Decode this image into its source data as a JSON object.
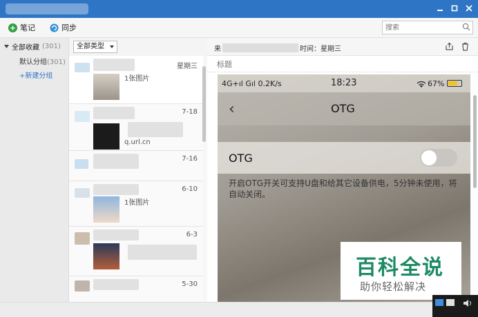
{
  "toolbar": {
    "note_label": "笔记",
    "sync_label": "同步",
    "search_placeholder": "搜索"
  },
  "sidebar": {
    "root_label": "全部收藏",
    "root_count": "(301)",
    "group_label": "默认分组",
    "group_count": "(301)",
    "new_group_label": "+新建分组"
  },
  "list": {
    "type_filter": "全部类型",
    "items": [
      {
        "date": "星期三",
        "caption": "1张图片"
      },
      {
        "date": "7-18",
        "caption": "q.url.cn"
      },
      {
        "date": "7-16",
        "caption": ""
      },
      {
        "date": "6-10",
        "caption": "1张图片"
      },
      {
        "date": "6-3",
        "caption": ""
      },
      {
        "date": "5-30",
        "caption": ""
      }
    ]
  },
  "detail": {
    "meta_prefix": "来",
    "meta_suffix": "时间：星期三",
    "title_placeholder": "标题"
  },
  "phone": {
    "status_left": "4G+ıl Gıl 0.2K/s",
    "status_time": "18:23",
    "status_battery": "67%",
    "nav_back": "‹",
    "nav_title": "OTG",
    "row_label": "OTG",
    "toggle_state": "off",
    "description": "开启OTG开关可支持U盘和给其它设备供电，5分钟未使用，将自动关闭。"
  },
  "watermark": {
    "main": "百科全说",
    "sub": "助你轻松解决"
  },
  "colors": {
    "titlebar": "#2f75c5",
    "accent": "#2f75c5",
    "note_icon": "#2e9f3e",
    "sync_icon": "#2f8fd8",
    "watermark_green": "#1d8a63",
    "battery_fill": "#f4c21c"
  }
}
